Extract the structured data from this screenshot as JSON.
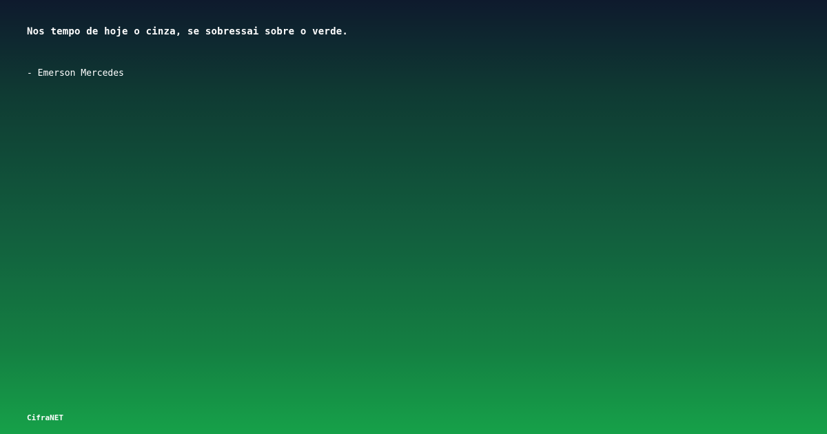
{
  "quote": {
    "text": "Nos tempo de hoje o cinza, se sobressai sobre o verde.",
    "author": "- Emerson Mercedes"
  },
  "brand": {
    "name": "CifraNET"
  },
  "colors": {
    "gradient_top": "#0e1a2d",
    "gradient_bottom": "#16a149",
    "text": "#ffffff"
  }
}
